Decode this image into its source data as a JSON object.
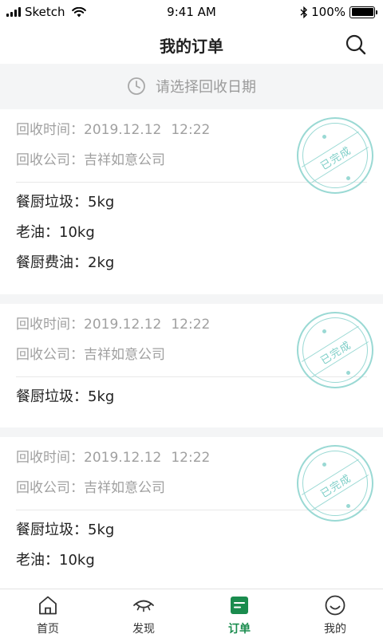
{
  "status_bar": {
    "carrier": "Sketch",
    "time": "9:41 AM",
    "battery": "100%"
  },
  "nav": {
    "title": "我的订单"
  },
  "date_filter": {
    "placeholder": "请选择回收日期"
  },
  "labels": {
    "time_label": "回收时间：",
    "company_label": "回收公司：",
    "stamp_text": "已完成"
  },
  "orders": [
    {
      "date": "2019.12.12",
      "time": "12:22",
      "company": "吉祥如意公司",
      "items": [
        "餐厨垃圾：5kg",
        "老油：10kg",
        "餐厨费油：2kg"
      ]
    },
    {
      "date": "2019.12.12",
      "time": "12:22",
      "company": "吉祥如意公司",
      "items": [
        "餐厨垃圾：5kg"
      ]
    },
    {
      "date": "2019.12.12",
      "time": "12:22",
      "company": "吉祥如意公司",
      "items": [
        "餐厨垃圾：5kg",
        "老油：10kg"
      ]
    }
  ],
  "tab_bar": {
    "items": [
      {
        "label": "首页",
        "icon": "home-icon"
      },
      {
        "label": "发现",
        "icon": "eye-icon"
      },
      {
        "label": "订单",
        "icon": "order-icon"
      },
      {
        "label": "我的",
        "icon": "smiley-icon"
      }
    ],
    "active_index": 2
  },
  "colors": {
    "accent": "#1a8c4e",
    "stamp": "#9ad9d4",
    "muted_text": "#a0a0a0"
  }
}
